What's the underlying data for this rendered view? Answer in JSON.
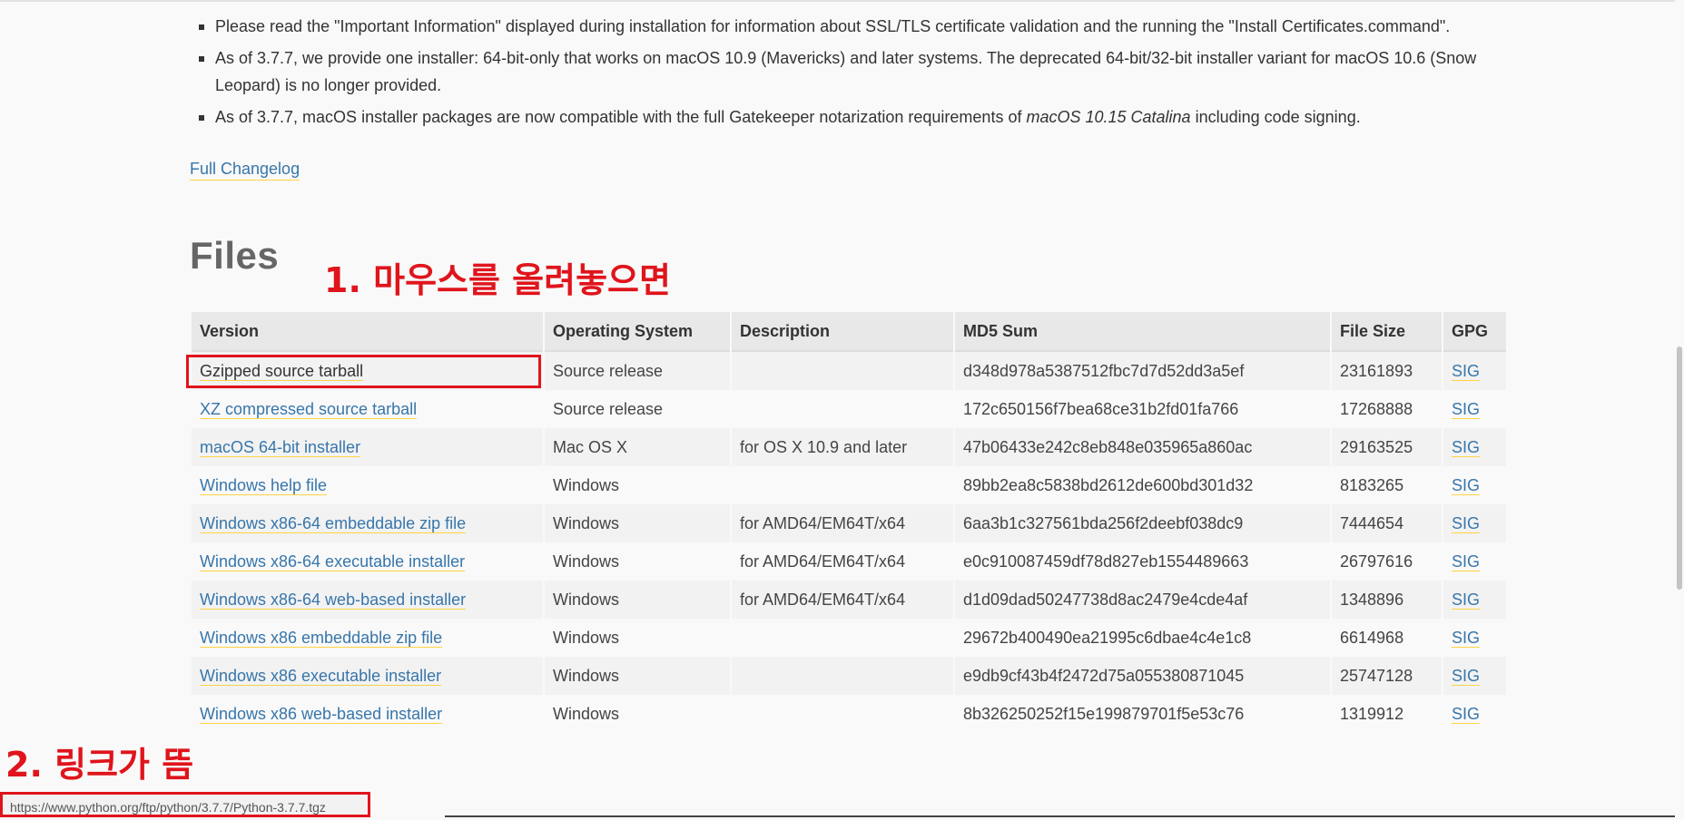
{
  "notes": [
    {
      "text": "Please read the \"Important Information\" displayed during installation for information about SSL/TLS certificate validation and the running the \"Install Certificates.command\"."
    },
    {
      "text": "As of 3.7.7, we provide one installer: 64-bit-only that works on macOS 10.9 (Mavericks) and later systems. The deprecated 64-bit/32-bit installer variant for macOS 10.6 (Snow Leopard) is no longer provided."
    },
    {
      "text_before": "As of 3.7.7, macOS installer packages are now compatible with the full Gatekeeper notarization requirements of ",
      "text_em": "macOS 10.15 Catalina",
      "text_after": " including code signing."
    }
  ],
  "changelog_link": "Full Changelog",
  "files_heading": "Files",
  "annotations": {
    "step1": "1. 마우스를 올려놓으면",
    "step2": "2. 링크가 뜸"
  },
  "table": {
    "headers": [
      "Version",
      "Operating System",
      "Description",
      "MD5 Sum",
      "File Size",
      "GPG"
    ],
    "rows": [
      {
        "version": "Gzipped source tarball",
        "os": "Source release",
        "desc": "",
        "md5": "d348d978a5387512fbc7d7d52dd3a5ef",
        "size": "23161893",
        "gpg": "SIG"
      },
      {
        "version": "XZ compressed source tarball",
        "os": "Source release",
        "desc": "",
        "md5": "172c650156f7bea68ce31b2fd01fa766",
        "size": "17268888",
        "gpg": "SIG"
      },
      {
        "version": "macOS 64-bit installer",
        "os": "Mac OS X",
        "desc": "for OS X 10.9 and later",
        "md5": "47b06433e242c8eb848e035965a860ac",
        "size": "29163525",
        "gpg": "SIG"
      },
      {
        "version": "Windows help file",
        "os": "Windows",
        "desc": "",
        "md5": "89bb2ea8c5838bd2612de600bd301d32",
        "size": "8183265",
        "gpg": "SIG"
      },
      {
        "version": "Windows x86-64 embeddable zip file",
        "os": "Windows",
        "desc": "for AMD64/EM64T/x64",
        "md5": "6aa3b1c327561bda256f2deebf038dc9",
        "size": "7444654",
        "gpg": "SIG"
      },
      {
        "version": "Windows x86-64 executable installer",
        "os": "Windows",
        "desc": "for AMD64/EM64T/x64",
        "md5": "e0c910087459df78d827eb1554489663",
        "size": "26797616",
        "gpg": "SIG"
      },
      {
        "version": "Windows x86-64 web-based installer",
        "os": "Windows",
        "desc": "for AMD64/EM64T/x64",
        "md5": "d1d09dad50247738d8ac2479e4cde4af",
        "size": "1348896",
        "gpg": "SIG"
      },
      {
        "version": "Windows x86 embeddable zip file",
        "os": "Windows",
        "desc": "",
        "md5": "29672b400490ea21995c6dbae4c4e1c8",
        "size": "6614968",
        "gpg": "SIG"
      },
      {
        "version": "Windows x86 executable installer",
        "os": "Windows",
        "desc": "",
        "md5": "e9db9cf43b4f2472d75a055380871045",
        "size": "25747128",
        "gpg": "SIG"
      },
      {
        "version": "Windows x86 web-based installer",
        "os": "Windows",
        "desc": "",
        "md5": "8b326250252f15e199879701f5e53c76",
        "size": "1319912",
        "gpg": "SIG"
      }
    ]
  },
  "status_bar": {
    "url": "https://www.python.org/ftp/python/3.7.7/Python-3.7.7.tgz"
  },
  "colors": {
    "link": "#3776ab",
    "link_underline": "#ffd343",
    "annotation": "#e0141c"
  }
}
